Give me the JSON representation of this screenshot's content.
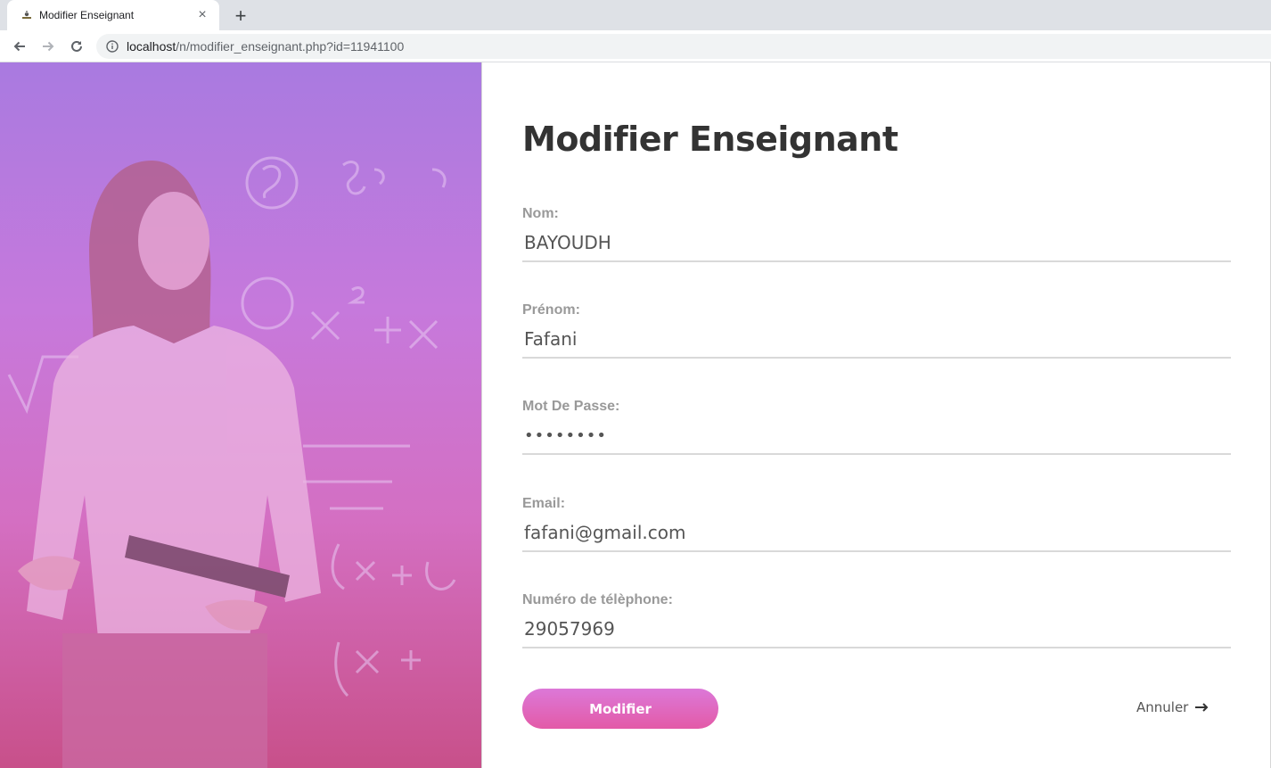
{
  "browser": {
    "tab_title": "Modifier Enseignant",
    "tab_close": "×",
    "new_tab": "+",
    "url_host": "localhost",
    "url_path": "/n/modifier_enseignant.php?id=11941100"
  },
  "page": {
    "title": "Modifier Enseignant",
    "fields": [
      {
        "label": "Nom:",
        "value": "BAYOUDH"
      },
      {
        "label": "Prénom:",
        "value": "Fafani"
      },
      {
        "label": "Mot De Passe:",
        "value": "••••••••"
      },
      {
        "label": "Email:",
        "value": "fafani@gmail.com"
      },
      {
        "label": "Numéro de télèphone:",
        "value": "29057969"
      }
    ],
    "submit_label": "Modifier",
    "cancel_label": "Annuler"
  },
  "colors": {
    "accent_gradient_start": "#dc78d8",
    "accent_gradient_end": "#e35aa7",
    "hero_overlay_top": "#a97ae0",
    "hero_overlay_bottom": "#c8508a"
  }
}
